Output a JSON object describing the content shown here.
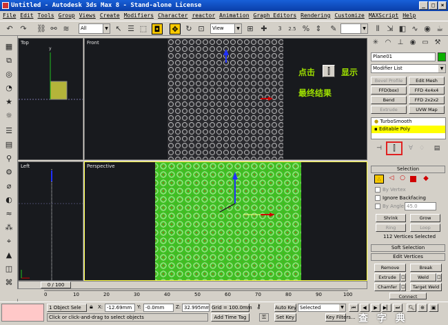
{
  "window": {
    "title": "Untitled - Autodesk 3ds Max 8  - Stand-alone License"
  },
  "menu": [
    "File",
    "Edit",
    "Tools",
    "Group",
    "Views",
    "Create",
    "Modifiers",
    "Character",
    "reactor",
    "Animation",
    "Graph Editors",
    "Rendering",
    "Customize",
    "MAXScript",
    "Help"
  ],
  "toolbar": {
    "selection_filter": "All",
    "ref_coord": "View",
    "snap_value": "2.5"
  },
  "viewports": {
    "top": "Top",
    "front": "Front",
    "left": "Left",
    "perspective": "Perspective"
  },
  "annotation": {
    "line1_a": "点击",
    "line1_b": "显示",
    "line2": "最终结果"
  },
  "command_panel": {
    "object_name": "Plane01",
    "name_color": "#0cb000",
    "modifier_list": "Modifier List",
    "modifier_buttons": [
      {
        "label": "Bevel Profile",
        "enabled": false
      },
      {
        "label": "Edit Mesh",
        "enabled": true
      },
      {
        "label": "FFD(box)",
        "enabled": true
      },
      {
        "label": "FFD 4x4x4",
        "enabled": true
      },
      {
        "label": "Bend",
        "enabled": true
      },
      {
        "label": "FFD 2x2x2",
        "enabled": true
      },
      {
        "label": "Extrude",
        "enabled": false
      },
      {
        "label": "UVW Map",
        "enabled": true
      }
    ],
    "stack": [
      {
        "label": "TurboSmooth",
        "selected": false
      },
      {
        "label": "Editable Poly",
        "selected": true
      }
    ],
    "selection_rollout": {
      "title": "Selection",
      "by_vertex": "By Vertex",
      "ignore_backfacing": "Ignore Backfacing",
      "by_angle": "By Angle:",
      "angle_value": "45.0",
      "shrink": "Shrink",
      "grow": "Grow",
      "ring": "Ring",
      "loop": "Loop",
      "status": "112 Vertices Selected"
    },
    "soft_selection": "Soft Selection",
    "edit_vertices": {
      "title": "Edit Vertices",
      "buttons": [
        "Remove",
        "Break",
        "Extrude",
        "Weld",
        "Chamfer",
        "Target Weld",
        "Connect"
      ]
    }
  },
  "timeline": {
    "slider": "0 / 100",
    "ticks": [
      "0",
      "10",
      "20",
      "30",
      "40",
      "50",
      "60",
      "70",
      "80",
      "90",
      "100"
    ]
  },
  "status": {
    "selection": "1 Object Sele",
    "x_label": "X:",
    "x": "-12.69mm",
    "y_label": "Y:",
    "y": "-0.0mm",
    "z_label": "Z:",
    "z": "32.995mm",
    "grid": "Grid = 100.0mm",
    "prompt": "Click or click-and-drag to select objects",
    "add_time_tag": "Add Time Tag",
    "auto_key": "Auto Key",
    "set_key": "Set Key",
    "key_mode": "Selected",
    "key_filters": "Key Filters..."
  },
  "watermark": "查 字 典"
}
